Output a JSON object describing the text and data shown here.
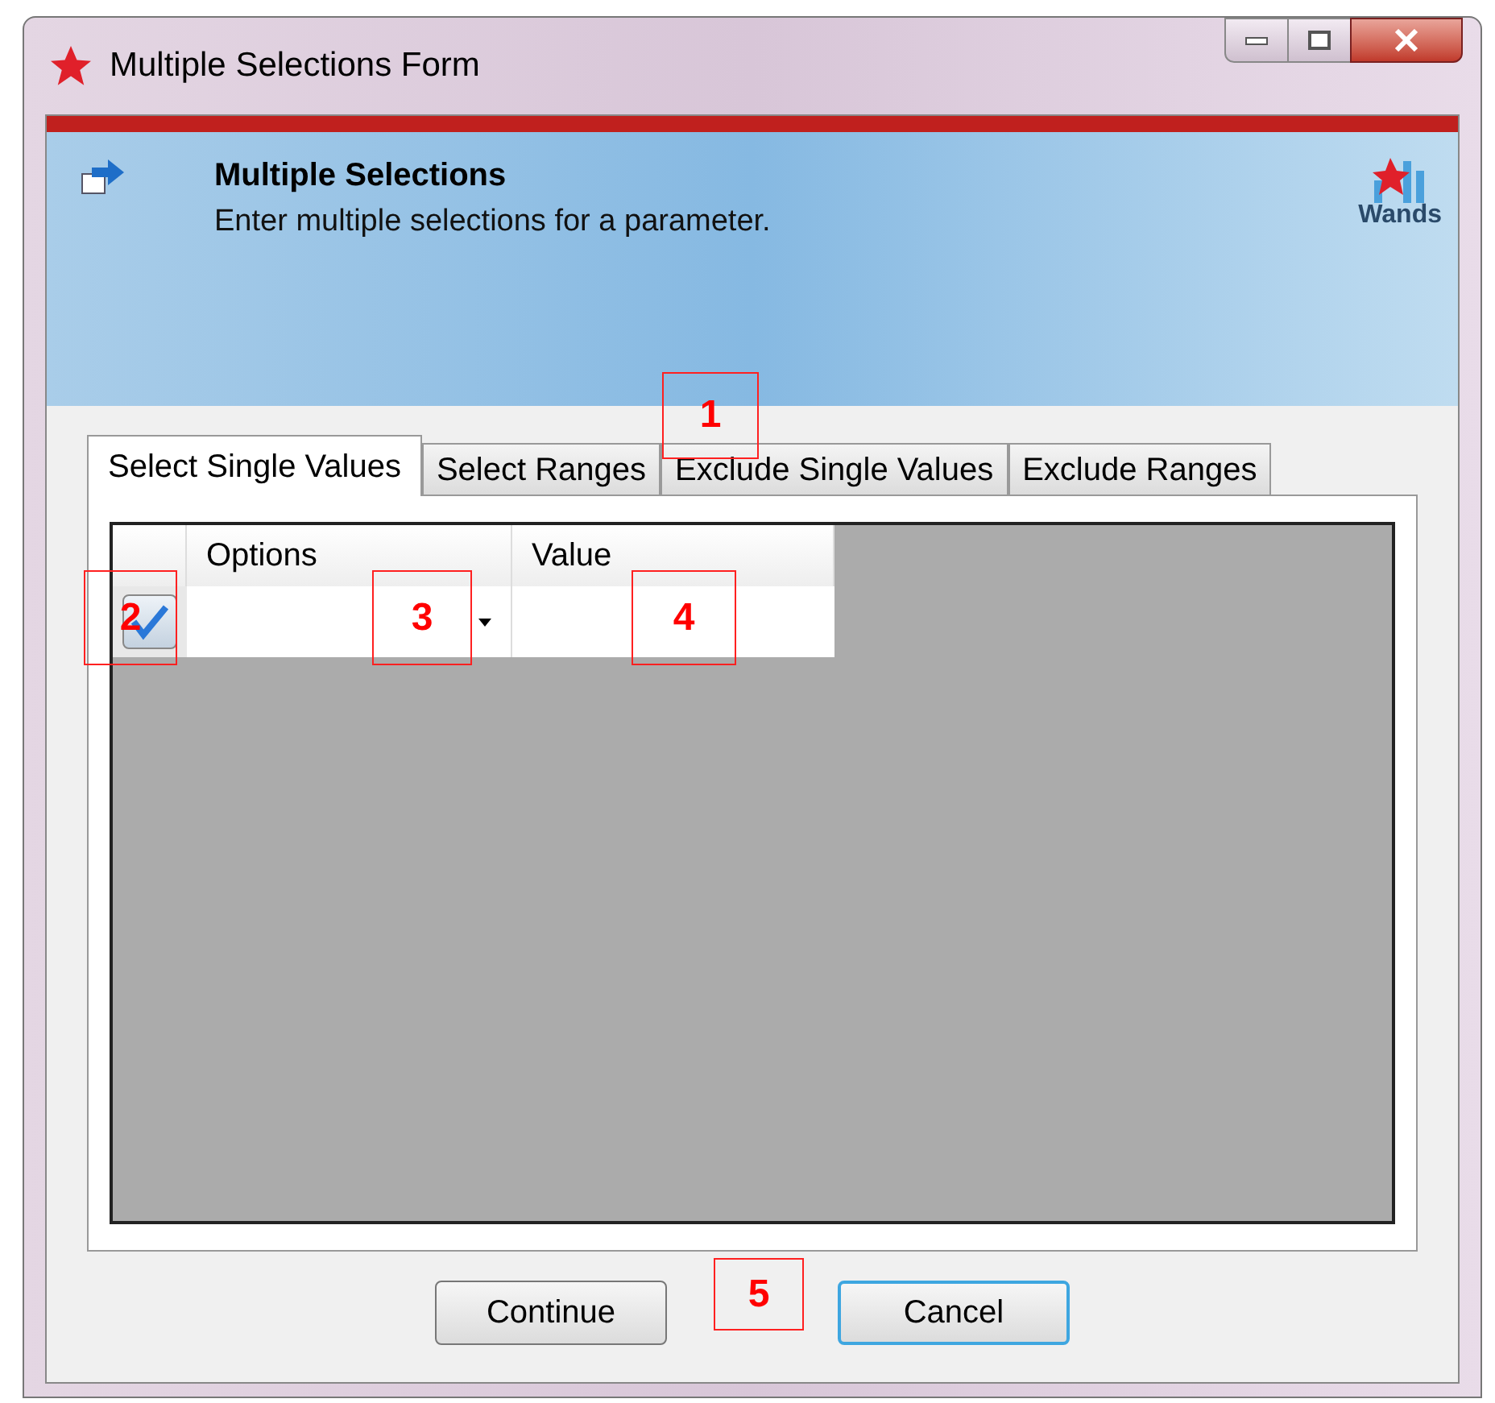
{
  "window": {
    "title": "Multiple Selections Form"
  },
  "header": {
    "title": "Multiple Selections",
    "subtitle": "Enter multiple selections for a parameter.",
    "logo_text": "Wands"
  },
  "tabs": [
    {
      "label": "Select Single Values",
      "selected": true
    },
    {
      "label": "Select Ranges",
      "selected": false
    },
    {
      "label": "Exclude Single Values",
      "selected": false
    },
    {
      "label": "Exclude Ranges",
      "selected": false
    }
  ],
  "grid": {
    "columns": [
      "Options",
      "Value"
    ],
    "rows": [
      {
        "checked": true
      }
    ]
  },
  "buttons": [
    {
      "label": "Continue",
      "focused": false
    },
    {
      "label": "Cancel",
      "focused": true
    }
  ],
  "callouts": [
    {
      "label": "1"
    },
    {
      "label": "2"
    },
    {
      "label": "3"
    },
    {
      "label": "4"
    },
    {
      "label": "5"
    }
  ]
}
